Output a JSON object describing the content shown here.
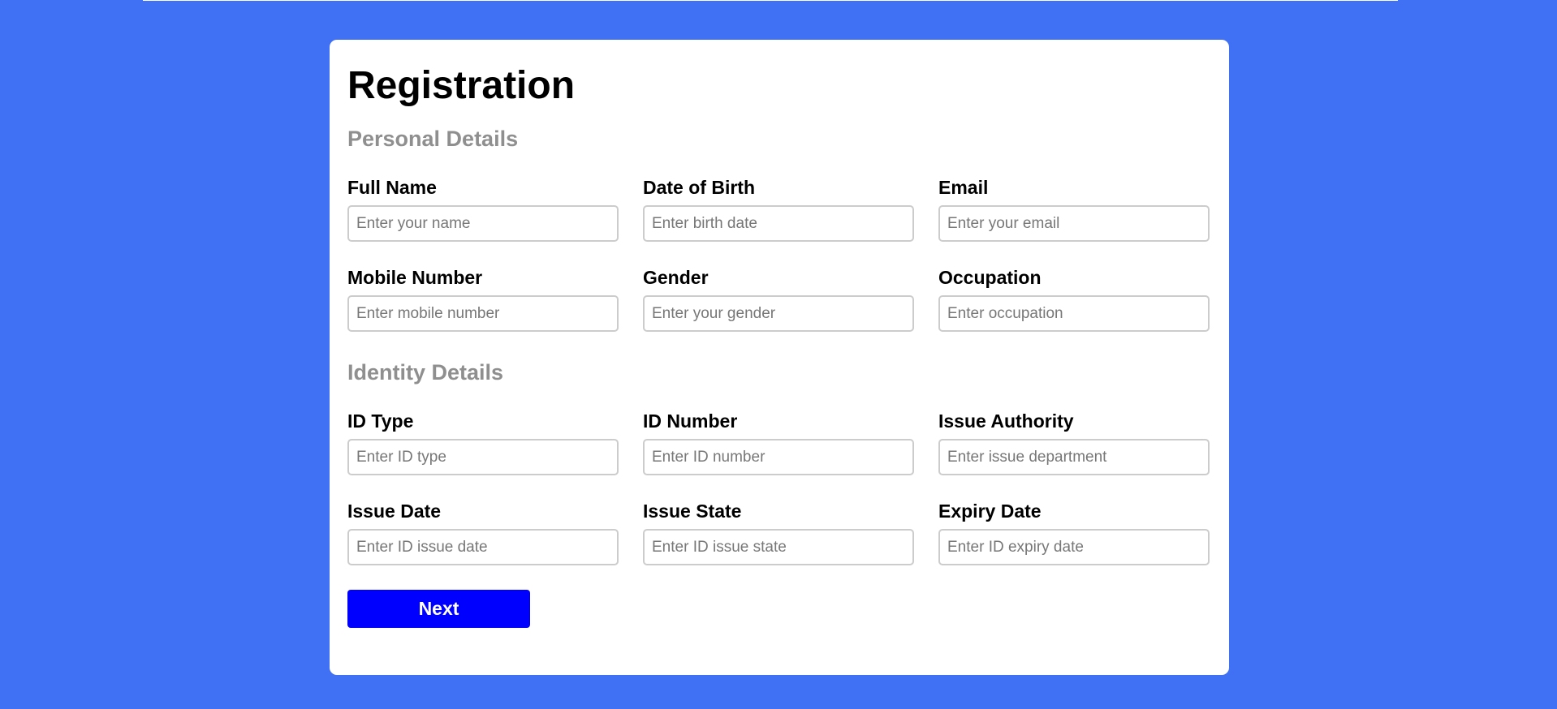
{
  "page": {
    "title": "Registration",
    "background_color": "#4070f4",
    "accent_color": "#0000ff"
  },
  "sections": {
    "personal": {
      "title": "Personal Details",
      "fields": [
        {
          "label": "Full Name",
          "placeholder": "Enter your name"
        },
        {
          "label": "Date of Birth",
          "placeholder": "Enter birth date"
        },
        {
          "label": "Email",
          "placeholder": "Enter your email"
        },
        {
          "label": "Mobile Number",
          "placeholder": "Enter mobile number"
        },
        {
          "label": "Gender",
          "placeholder": "Enter your gender"
        },
        {
          "label": "Occupation",
          "placeholder": "Enter occupation"
        }
      ]
    },
    "identity": {
      "title": "Identity Details",
      "fields": [
        {
          "label": "ID Type",
          "placeholder": "Enter ID type"
        },
        {
          "label": "ID Number",
          "placeholder": "Enter ID number"
        },
        {
          "label": "Issue Authority",
          "placeholder": "Enter issue department"
        },
        {
          "label": "Issue Date",
          "placeholder": "Enter ID issue date"
        },
        {
          "label": "Issue State",
          "placeholder": "Enter ID issue state"
        },
        {
          "label": "Expiry Date",
          "placeholder": "Enter ID expiry date"
        }
      ]
    }
  },
  "actions": {
    "next_label": "Next"
  }
}
